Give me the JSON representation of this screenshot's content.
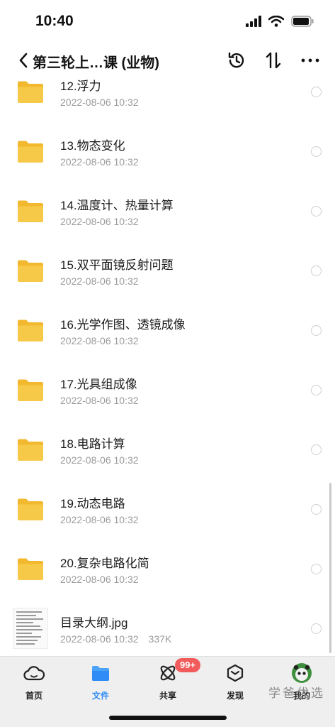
{
  "status_bar": {
    "time": "10:40",
    "icons": [
      "signal-icon",
      "wifi-icon",
      "battery-icon"
    ]
  },
  "nav": {
    "back_icon": "chevron-left-icon",
    "title": "第三轮上…课 (业物)",
    "actions": [
      "history-icon",
      "sort-icon",
      "more-icon"
    ]
  },
  "files": [
    {
      "name": "12.浮力",
      "date": "2022-08-06 10:32",
      "type": "folder"
    },
    {
      "name": "13.物态变化",
      "date": "2022-08-06 10:32",
      "type": "folder"
    },
    {
      "name": "14.温度计、热量计算",
      "date": "2022-08-06 10:32",
      "type": "folder"
    },
    {
      "name": "15.双平面镜反射问题",
      "date": "2022-08-06 10:32",
      "type": "folder"
    },
    {
      "name": "16.光学作图、透镜成像",
      "date": "2022-08-06 10:32",
      "type": "folder"
    },
    {
      "name": "17.光具组成像",
      "date": "2022-08-06 10:32",
      "type": "folder"
    },
    {
      "name": "18.电路计算",
      "date": "2022-08-06 10:32",
      "type": "folder"
    },
    {
      "name": "19.动态电路",
      "date": "2022-08-06 10:32",
      "type": "folder"
    },
    {
      "name": "20.复杂电路化简",
      "date": "2022-08-06 10:32",
      "type": "folder"
    },
    {
      "name": "目录大纲.jpg",
      "date": "2022-08-06 10:32",
      "size": "337K",
      "type": "image"
    }
  ],
  "tabs": [
    {
      "label": "首页",
      "icon": "cloud-icon",
      "active": false
    },
    {
      "label": "文件",
      "icon": "folder-icon",
      "active": true
    },
    {
      "label": "共享",
      "icon": "share-icon",
      "active": false,
      "badge": "99+"
    },
    {
      "label": "发现",
      "icon": "discover-icon",
      "active": false
    },
    {
      "label": "我的",
      "icon": "avatar-icon",
      "active": false
    }
  ],
  "watermark": "学爸优选",
  "colors": {
    "folder": "#f7c948",
    "accent": "#2f8cf6",
    "badge": "#f25b5b",
    "meta_text": "#9b9b9b"
  }
}
